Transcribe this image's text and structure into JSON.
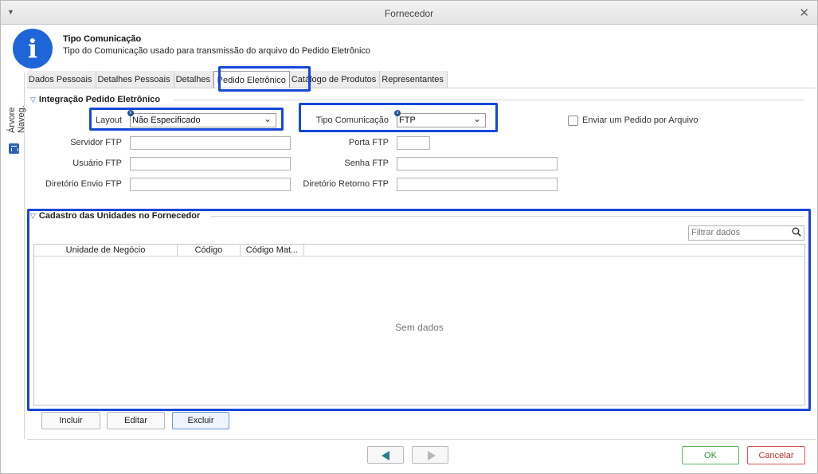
{
  "window": {
    "title": "Fornecedor"
  },
  "header": {
    "title": "Tipo Comunicação",
    "description": "Tipo do Comunicação usado para transmissão do arquivo do Pedido Eletrônico",
    "icon": "info-icon"
  },
  "sidebar": {
    "label": "Árvore Naveg.",
    "icon": "tree-icon"
  },
  "tabs": [
    {
      "label": "Dados Pessoais"
    },
    {
      "label": "Detalhes Pessoais"
    },
    {
      "label": "Detalhes"
    },
    {
      "label": "Pedido Eletrônico",
      "active": true
    },
    {
      "label": "Catálogo de Produtos"
    },
    {
      "label": "Representantes"
    }
  ],
  "integration": {
    "section_title": "Integração Pedido Eletrônico",
    "layout_label": "Layout",
    "layout_value": "Não Especificado",
    "tipo_label": "Tipo Comunicação",
    "tipo_value": "FTP",
    "enviar_label": "Enviar um Pedido por Arquivo",
    "servidor_label": "Servidor FTP",
    "porta_label": "Porta FTP",
    "usuario_label": "Usuário FTP",
    "senha_label": "Senha FTP",
    "dir_envio_label": "Diretório Envio FTP",
    "dir_retorno_label": "Diretório Retorno FTP"
  },
  "units": {
    "section_title": "Cadastro das Unidades no Fornecedor",
    "filter_placeholder": "Filtrar dados",
    "columns": [
      "Unidade de Negócio",
      "Código",
      "Código Mat..."
    ],
    "empty_text": "Sem dados",
    "buttons": {
      "incluir": "Incluir",
      "editar": "Editar",
      "excluir": "Excluir"
    }
  },
  "footer": {
    "ok": "OK",
    "cancel": "Cancelar"
  },
  "colors": {
    "accent": "#1d65d8",
    "highlight": "#1648d8",
    "ok": "#5bb85b",
    "cancel": "#d65757"
  }
}
